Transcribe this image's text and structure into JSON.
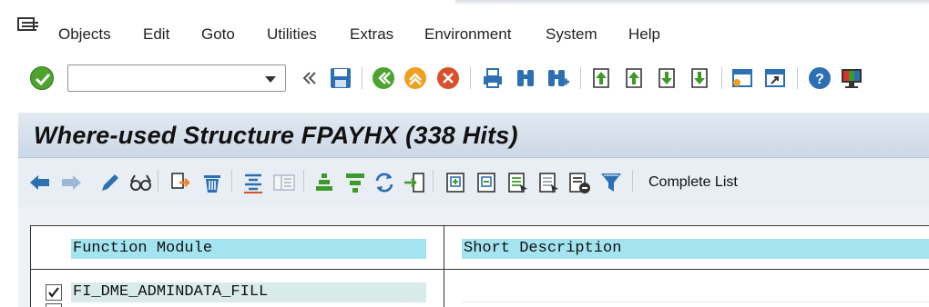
{
  "menubar": {
    "items": [
      "Objects",
      "Edit",
      "Goto",
      "Utilities",
      "Extras",
      "Environment",
      "System",
      "Help"
    ]
  },
  "toolbar": {
    "command_value": "",
    "icons": [
      "enter-icon",
      "back-icon",
      "exit-icon",
      "cancel-icon",
      "print-icon",
      "find-icon",
      "find-next-icon",
      "first-page-icon",
      "previous-page-icon",
      "next-page-icon",
      "last-page-icon",
      "create-session-icon",
      "generate-shortcut-icon",
      "help-icon",
      "customize-layout-icon"
    ]
  },
  "title": {
    "text": "Where-used Structure FPAYHX (338 Hits)"
  },
  "app_toolbar": {
    "complete_list_label": "Complete List"
  },
  "list": {
    "headers": [
      "Function Module",
      "Short Description"
    ],
    "rows": [
      {
        "checked": true,
        "function_module": "FI_DME_ADMINDATA_FILL",
        "short_description": ""
      }
    ]
  },
  "colors": {
    "header_cell": "#a4e4f0",
    "title_bar": "#cbd8e6",
    "ok_green": "#4da32e"
  }
}
